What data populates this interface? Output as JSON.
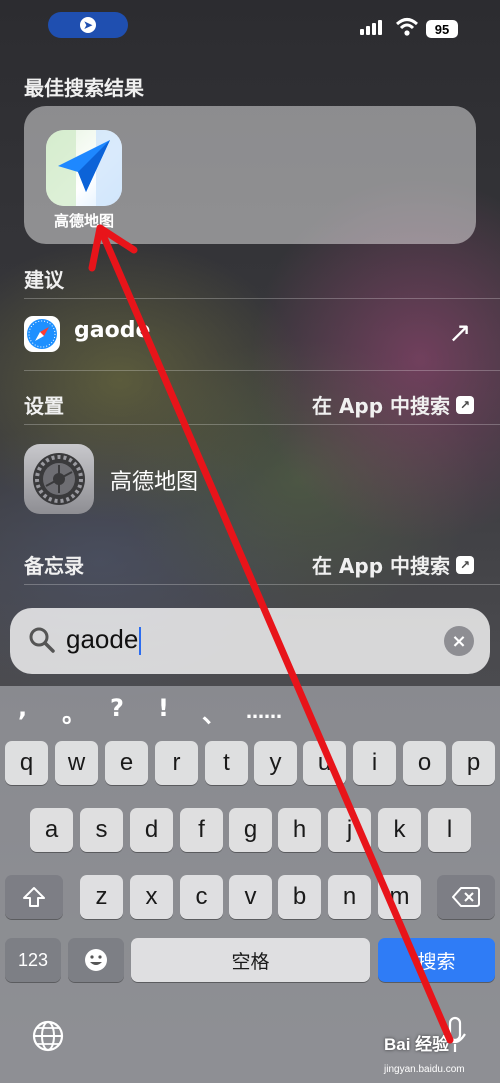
{
  "status_bar": {
    "battery": "95"
  },
  "top_hit": {
    "section_title": "最佳搜索结果",
    "app_name": "高德地图"
  },
  "suggestions": {
    "section_title": "建议",
    "item_text": "gaode"
  },
  "settings": {
    "section_title": "设置",
    "search_in_app": "在 App 中搜索",
    "item_text": "高德地图"
  },
  "notes": {
    "section_title": "备忘录",
    "search_in_app": "在 App 中搜索"
  },
  "search": {
    "value": "gaode",
    "search_icon": "magnifier-icon",
    "clear_icon": "clear-icon"
  },
  "keyboard": {
    "candidates": [
      ",",
      "。",
      "?",
      "!",
      "、",
      "……"
    ],
    "row1": [
      "q",
      "w",
      "e",
      "r",
      "t",
      "y",
      "u",
      "i",
      "o",
      "p"
    ],
    "row2": [
      "a",
      "s",
      "d",
      "f",
      "g",
      "h",
      "j",
      "k",
      "l"
    ],
    "row3": [
      "z",
      "x",
      "c",
      "v",
      "b",
      "n",
      "m"
    ],
    "numbers_key": "123",
    "space_key": "空格",
    "return_key": "搜索"
  },
  "watermark": {
    "text": "Bai 经验",
    "sub": "jingyan.baidu.com"
  },
  "colors": {
    "accent_blue": "#2f7cf6",
    "annotation_red": "#e8141a",
    "pill_blue": "#1f4fb0"
  }
}
